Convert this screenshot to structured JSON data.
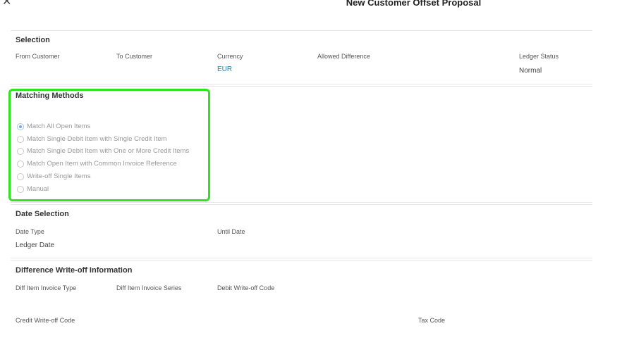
{
  "dialog": {
    "title": "New Customer Offset Proposal",
    "close_icon": "close-icon"
  },
  "selection": {
    "title": "Selection",
    "from_customer_label": "From Customer",
    "to_customer_label": "To Customer",
    "currency_label": "Currency",
    "currency_value": "EUR",
    "allowed_difference_label": "Allowed Difference",
    "ledger_status_label": "Ledger Status",
    "ledger_status_value": "Normal"
  },
  "matching": {
    "title": "Matching Methods",
    "options": [
      {
        "label": "Match All Open Items",
        "checked": true
      },
      {
        "label": "Match Single Debit Item with Single Credit Item",
        "checked": false
      },
      {
        "label": "Match Single Debit Item with One or More Credit Items",
        "checked": false
      },
      {
        "label": "Match Open Item with Common Invoice Reference",
        "checked": false
      },
      {
        "label": "Write-off Single Items",
        "checked": false
      },
      {
        "label": "Manual",
        "checked": false
      }
    ],
    "highlight_color": "#2ce51f"
  },
  "date_selection": {
    "title": "Date Selection",
    "date_type_label": "Date Type",
    "date_type_value": "Ledger Date",
    "until_date_label": "Until Date"
  },
  "writeoff": {
    "title": "Difference Write-off Information",
    "diff_item_invoice_type_label": "Diff Item Invoice Type",
    "diff_item_invoice_series_label": "Diff Item Invoice Series",
    "debit_writeoff_code_label": "Debit Write-off Code",
    "credit_writeoff_code_label": "Credit Write-off Code",
    "tax_code_label": "Tax Code"
  },
  "colors": {
    "link": "#1f7fb5",
    "radio_selected": "#7aa6dd"
  }
}
